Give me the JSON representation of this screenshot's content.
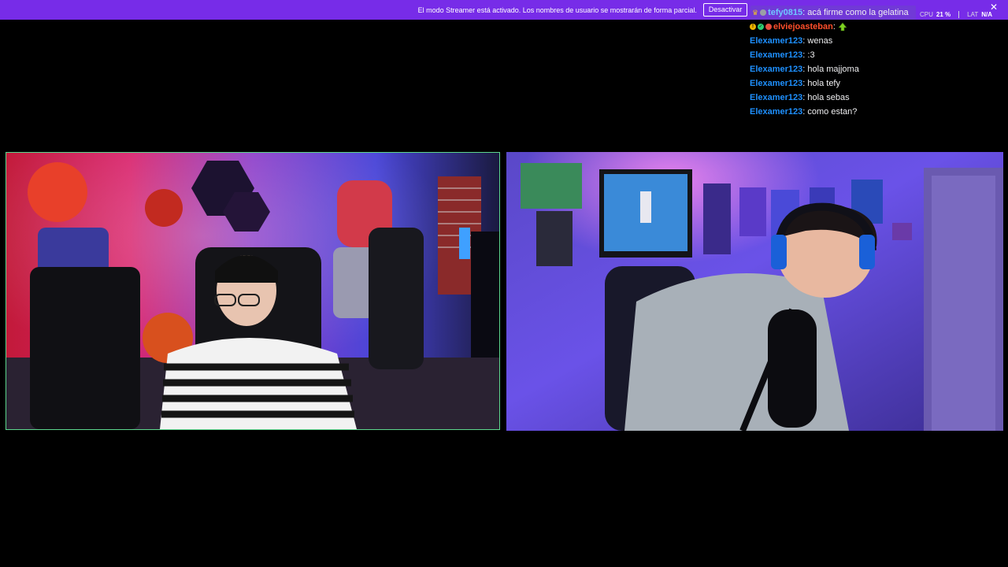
{
  "banner": {
    "text": "El modo Streamer está activado. Los nombres de usuario se mostrarán de forma parcial.",
    "button_label": "Desactivar"
  },
  "stats": {
    "cpu_label": "CPU",
    "cpu_value": "21 %",
    "lat_label": "LAT",
    "lat_value": "N/A"
  },
  "chat": {
    "messages": [
      {
        "user": "tefy0815",
        "text": "acá firme como la gelatina",
        "color": "#6fc8ff",
        "highlighted": true
      },
      {
        "user": "elviejoasteban",
        "text": "",
        "color": "#ff4f2b",
        "emote": "arrow-emote-icon"
      },
      {
        "user": "Elexamer123",
        "text": "wenas",
        "color": "#1e90ff"
      },
      {
        "user": "Elexamer123",
        "text": ":3",
        "color": "#1e90ff"
      },
      {
        "user": "Elexamer123",
        "text": "hola majjoma",
        "color": "#1e90ff"
      },
      {
        "user": "Elexamer123",
        "text": "hola tefy",
        "color": "#1e90ff"
      },
      {
        "user": "Elexamer123",
        "text": "hola sebas",
        "color": "#1e90ff"
      },
      {
        "user": "Elexamer123",
        "text": "como estan?",
        "color": "#1e90ff"
      }
    ]
  },
  "colors": {
    "banner": "#772ce8",
    "left_cam_border": "#5dd68e",
    "background": "#000000"
  }
}
